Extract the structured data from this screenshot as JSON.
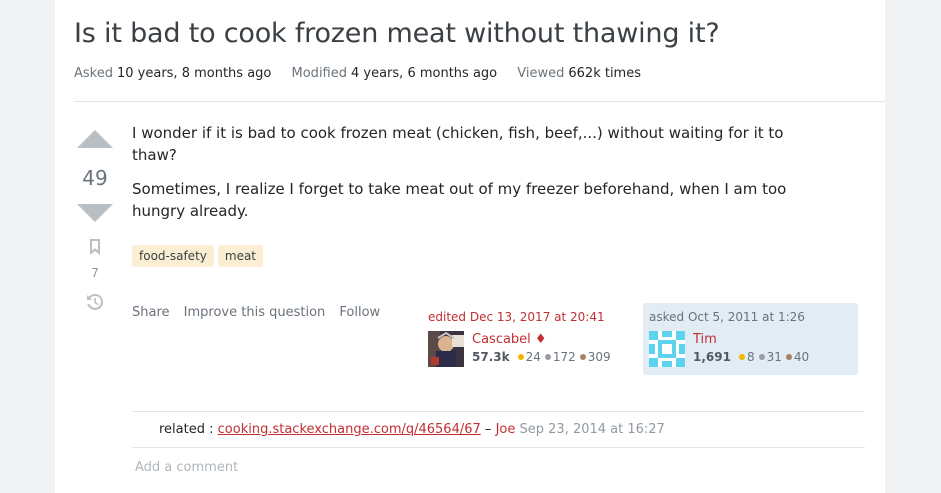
{
  "question": {
    "title": "Is it bad to cook frozen meat without thawing it?",
    "meta": {
      "asked_label": "Asked",
      "asked_value": "10 years, 8 months ago",
      "modified_label": "Modified",
      "modified_value": "4 years, 6 months ago",
      "viewed_label": "Viewed",
      "viewed_value": "662k times"
    },
    "score": "49",
    "bookmark_count": "7",
    "body": [
      "I wonder if it is bad to cook frozen meat (chicken, fish, beef,...) without waiting for it to thaw?",
      "Sometimes, I realize I forget to take meat out of my freezer beforehand, when I am too hungry already."
    ],
    "tags": [
      "food-safety",
      "meat"
    ],
    "actions": {
      "share": "Share",
      "improve": "Improve this question",
      "follow": "Follow"
    }
  },
  "editor": {
    "when": "edited Dec 13, 2017 at 20:41",
    "name": "Cascabel ♦",
    "rep": "57.3k",
    "gold": "24",
    "silver": "172",
    "bronze": "309"
  },
  "owner": {
    "when": "asked Oct 5, 2011 at 1:26",
    "name": "Tim",
    "rep": "1,691",
    "gold": "8",
    "silver": "31",
    "bronze": "40"
  },
  "comment": {
    "prefix": "related :",
    "link": "cooking.stackexchange.com/q/46564/67",
    "dash": "–",
    "user": "Joe",
    "date": "Sep 23, 2014 at 16:27"
  },
  "add_comment": "Add a comment",
  "colors": {
    "accent": "#c22e32",
    "tag_bg": "#fbefd3",
    "owner_bg": "#e1ecf4",
    "gold": "#f1b600",
    "silver": "#9a9c9f",
    "bronze": "#ab825f"
  }
}
